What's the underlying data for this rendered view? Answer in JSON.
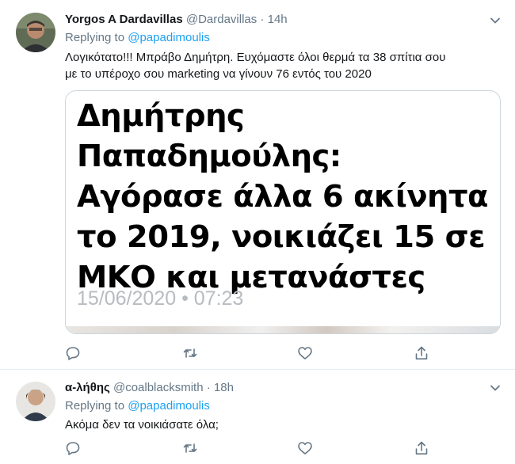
{
  "tweets": [
    {
      "display_name": "Yorgos A Dardavillas",
      "handle": "@Dardavillas",
      "separator": "·",
      "time": "14h",
      "replying_label": "Replying to",
      "replying_to": "@papadimoulis",
      "text_line1": "Λογικότατο!!! Μπράβο Δημήτρη. Ευχόμαστε όλοι θερμά τα 38 σπίτια σου",
      "text_line2": "με το υπέροχο σου marketing να γίνουν 76 εντός του 2020",
      "card": {
        "headline": "Δημήτρης Παπαδημούλης: Αγόρασε άλλα 6 ακίνητα το 2019, νοικιάζει 15 σε ΜΚΟ και μετανάστες",
        "date": "15/06/2020 • 07:23"
      }
    },
    {
      "display_name": "α-λήθης",
      "handle": "@coalblacksmith",
      "separator": "·",
      "time": "18h",
      "replying_label": "Replying to",
      "replying_to": "@papadimoulis",
      "text": "Ακόμα δεν τα νοικιάσατε όλα;"
    }
  ],
  "icons": [
    "reply-icon",
    "retweet-icon",
    "like-icon",
    "share-icon",
    "chevron-down-icon"
  ],
  "colors": {
    "link": "#1da1f2",
    "secondary": "#657786",
    "border": "#e6ecf0"
  }
}
